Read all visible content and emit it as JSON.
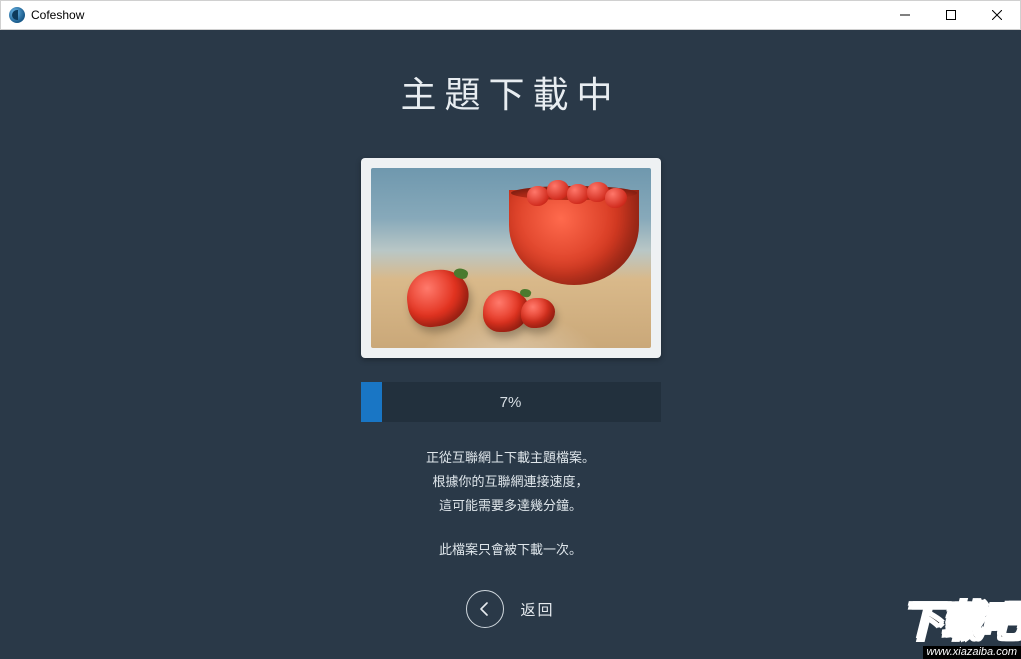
{
  "titlebar": {
    "app_name": "Cofeshow"
  },
  "main": {
    "heading": "主題下載中",
    "progress": {
      "percent": 7,
      "label": "7%"
    },
    "status": {
      "line1": "正從互聯網上下載主題檔案。",
      "line2": "根據你的互聯網連接速度，",
      "line3": "這可能需要多達幾分鐘。",
      "line4": "此檔案只會被下載一次。"
    },
    "back_label": "返回"
  },
  "watermark": {
    "text": "下载吧",
    "url": "www.xiazaiba.com"
  }
}
